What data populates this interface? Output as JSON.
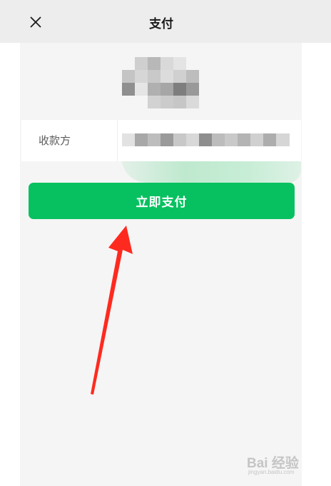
{
  "header": {
    "title": "支付",
    "close_icon": "close-icon"
  },
  "payee": {
    "label": "收款方"
  },
  "actions": {
    "pay_label": "立即支付"
  },
  "colors": {
    "accent": "#07c160",
    "header_bg": "#ededed",
    "screen_bg": "#f5f5f5",
    "annotation_arrow": "#ff2a1f"
  },
  "watermark": {
    "brand": "Bai 经验",
    "sub": "jingyan.baidu.com"
  }
}
